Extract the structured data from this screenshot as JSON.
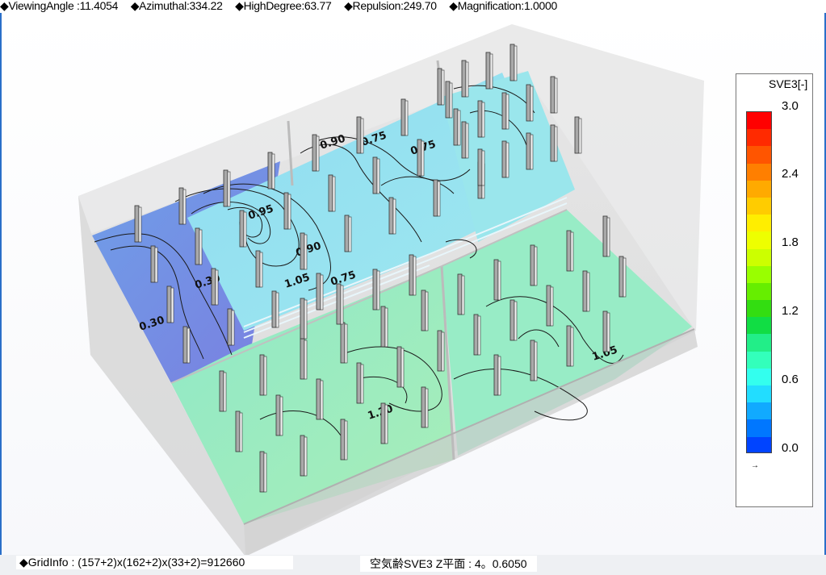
{
  "top_status": {
    "viewing_angle": "◆ViewingAngle :11.4054",
    "azimuthal": "◆Azimuthal:334.22",
    "high_degree": "◆HighDegree:63.77",
    "repulsion": "◆Repulsion:249.70",
    "magnification": "◆Magnification:1.0000"
  },
  "legend": {
    "title": "SVE3[-]",
    "labels": [
      "3.0",
      "2.4",
      "1.8",
      "1.2",
      "0.6",
      "0.0"
    ],
    "colors": [
      "#ff0000",
      "#ff2a00",
      "#ff5500",
      "#ff7f00",
      "#ffaa00",
      "#ffcc00",
      "#ffee00",
      "#eeff00",
      "#ccff00",
      "#99ff00",
      "#66ee00",
      "#33dd11",
      "#11dd44",
      "#22ee88",
      "#33ffbb",
      "#33ffee",
      "#22ddff",
      "#11aaff",
      "#0077ff",
      "#0044ff"
    ],
    "arrow": "→"
  },
  "contours": {
    "labels": [
      "0.90",
      "0.75",
      "0.75",
      "0.95",
      "0.90",
      "0.30",
      "1.05",
      "0.75",
      "0.30",
      "1.20",
      "1.05"
    ]
  },
  "bottom_status": {
    "grid_info": "◆GridInfo : (157+2)x(162+2)x(33+2)=912660",
    "plane_info": "空気齢SVE3 Z平面 : 4。0.6050"
  }
}
